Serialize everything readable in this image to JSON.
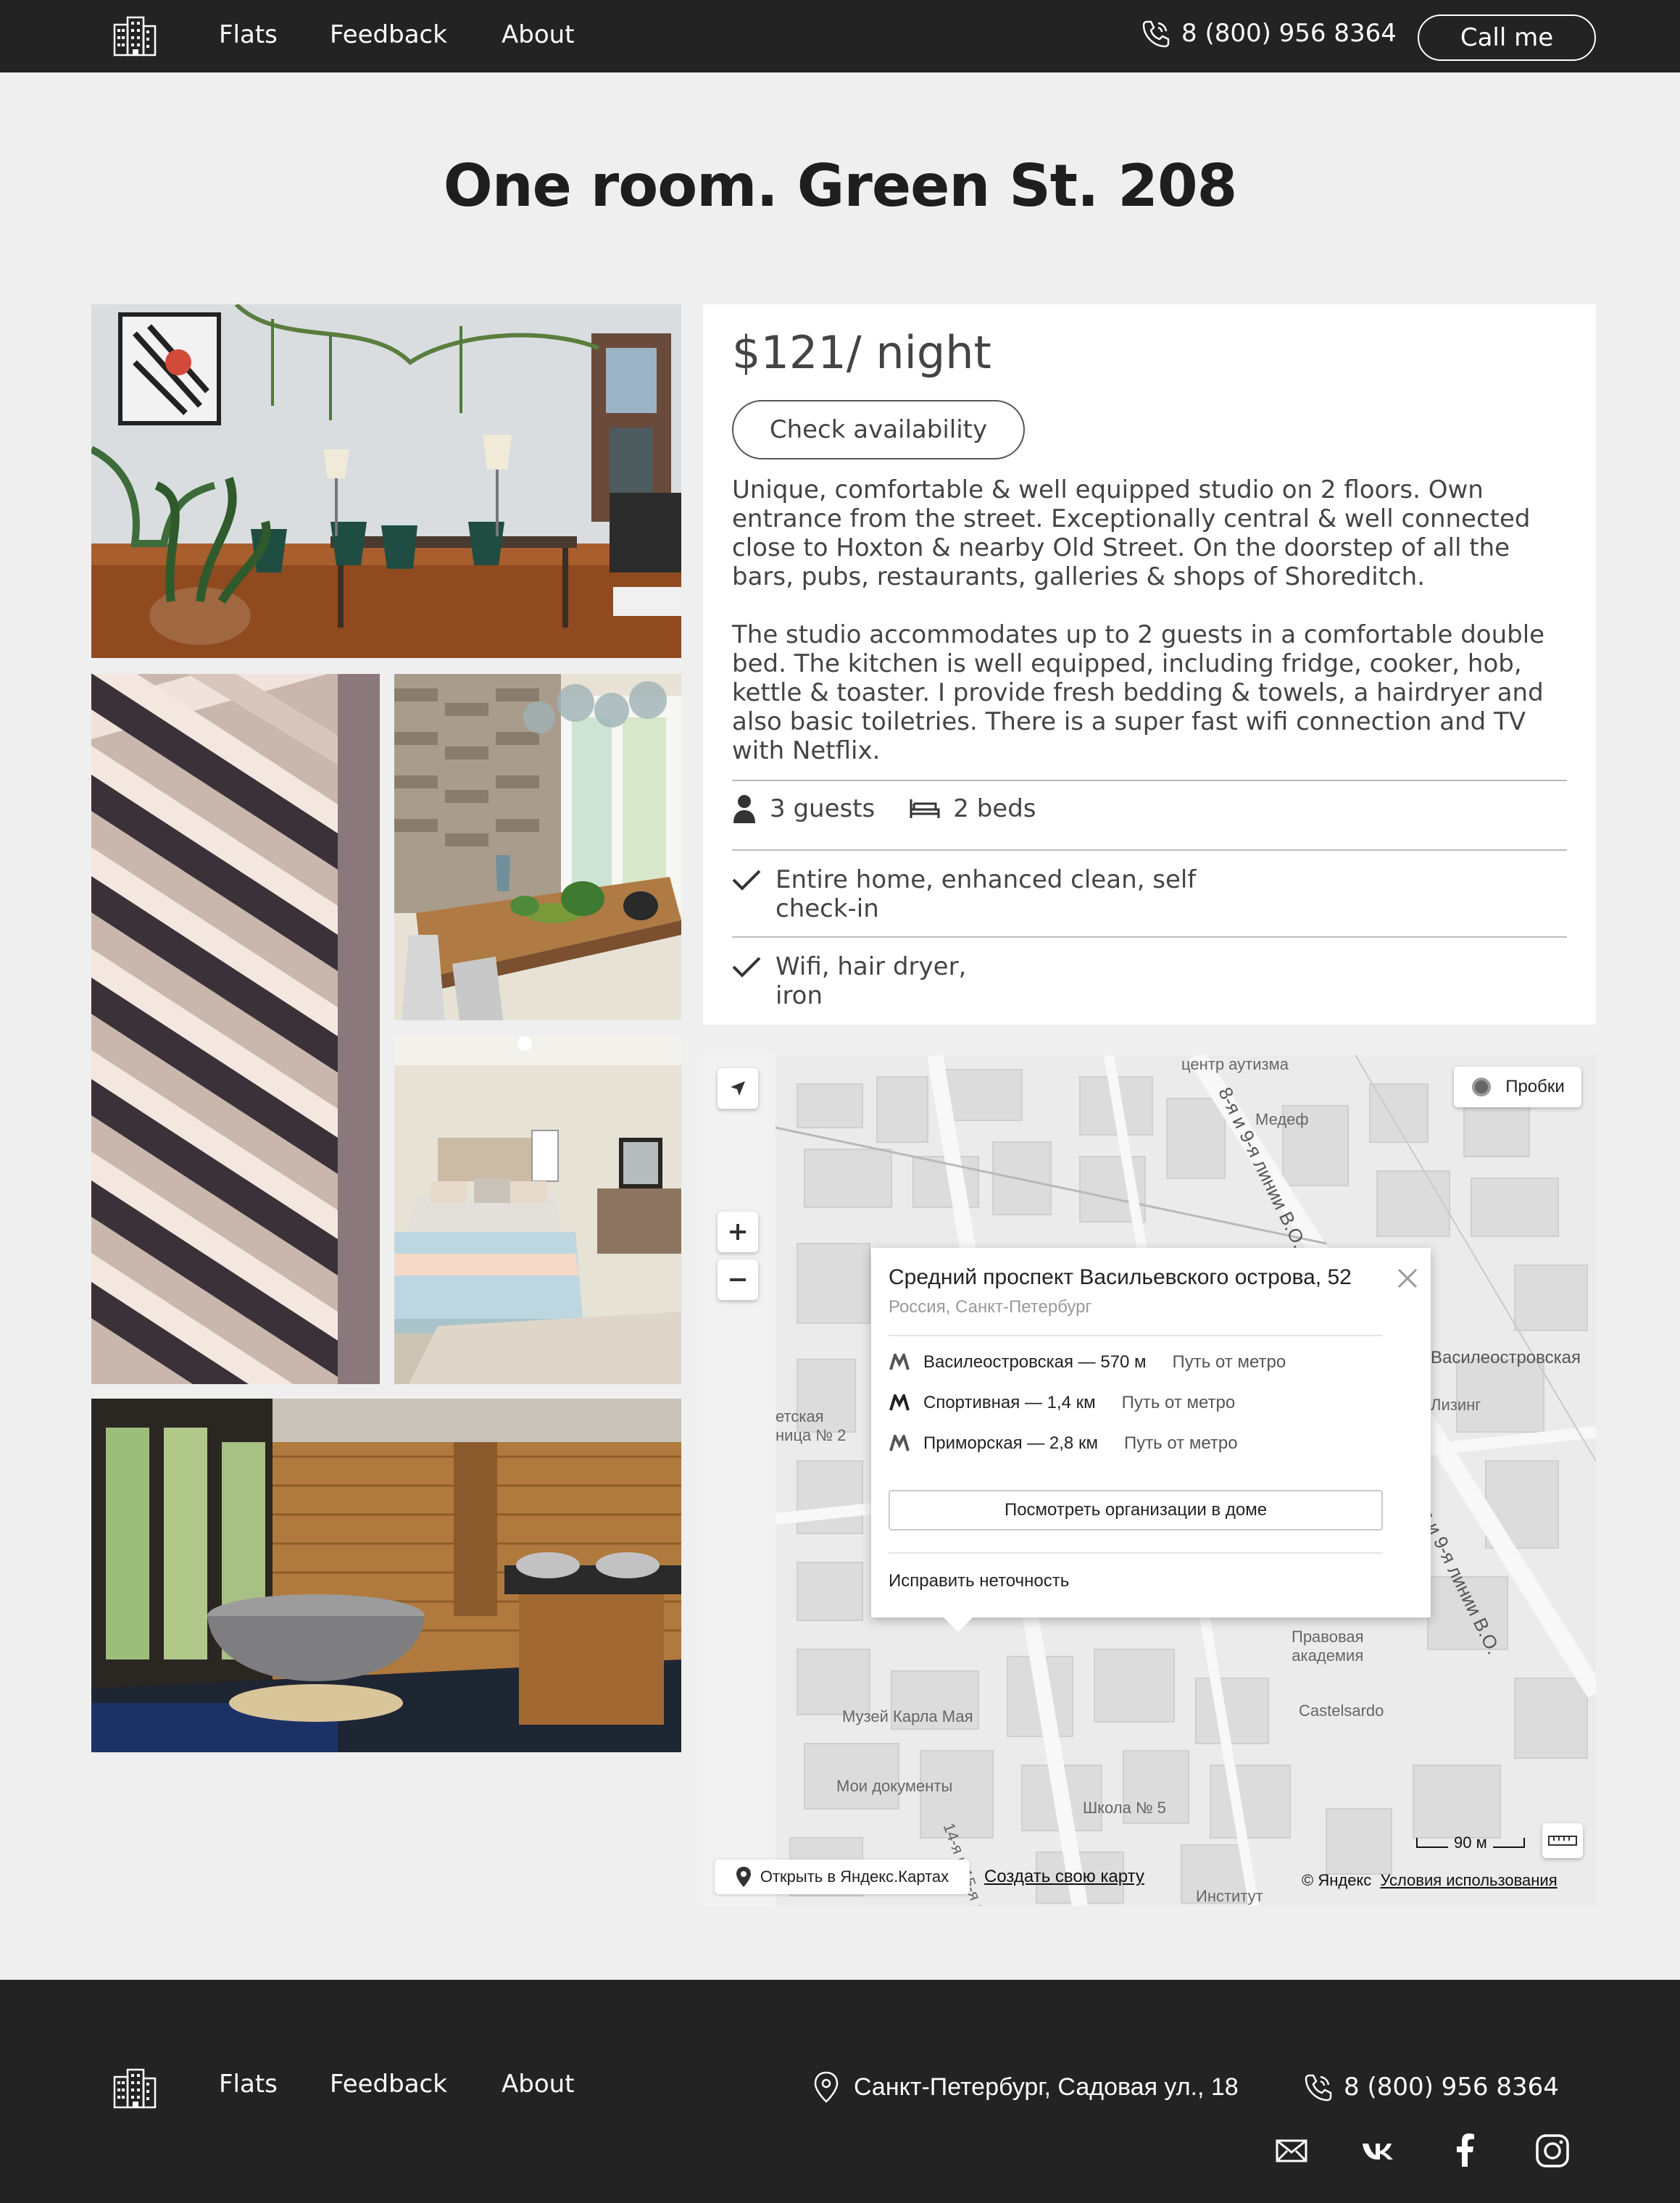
{
  "header": {
    "nav": [
      "Flats",
      "Feedback",
      "About"
    ],
    "phone": "8 (800) 956 8364",
    "call_button": "Call me"
  },
  "page": {
    "title": "One room. Green St. 208"
  },
  "listing": {
    "price": "$121/ night",
    "check_button": "Check availability",
    "description_1": "Unique, comfortable & well equipped studio on 2 floors. Own entrance from the street. Exceptionally central & well connected close to Hoxton & nearby Old Street. On the doorstep of all the bars, pubs, restaurants, galleries & shops of Shoreditch.",
    "description_2": "The studio accommodates up to 2 guests in a comfortable double bed. The kitchen is well equipped, including fridge, cooker, hob, kettle & toaster. I provide fresh bedding & towels, a hairdryer and also basic toiletries. There is a super fast wifi connection and TV with Netflix.",
    "guests": "3 guests",
    "beds": "2 beds",
    "feature_1_line1": "Entire home, enhanced clean, self",
    "feature_1_line2": "check-in",
    "feature_2_line1": "Wifi, hair dryer,",
    "feature_2_line2": "iron"
  },
  "map": {
    "traffic_button": "Пробки",
    "popup_title": "Средний проспект Васильевского острова, 52",
    "popup_subtitle": "Россия, Санкт-Петербург",
    "metro": [
      {
        "name": "Василеостровская — 570 м",
        "path": "Путь от метро"
      },
      {
        "name": "Спортивная — 1,4 км",
        "path": "Путь от метро"
      },
      {
        "name": "Приморская — 2,8 км",
        "path": "Путь от метро"
      }
    ],
    "orgs_button": "Посмотреть организации в доме",
    "fix_link": "Исправить неточность",
    "open_link": "Открыть в Яндекс.Картах",
    "create_link": "Создать свою карту",
    "copyright": "© Яндекс",
    "terms_link": "Условия использования",
    "scale": "90 м",
    "labels": {
      "center": "центр аутизма",
      "medef": "Медеф",
      "line_upper": "8-я и 9-я линии В.О.",
      "line_lower": "8-я и 9-я линии В.О.",
      "vasileo": "Василеостровская",
      "leasing": "Лизинг",
      "school_left": "етская\nница № 2",
      "museum": "Музей Карла Мая",
      "docs": "Мои документы",
      "school5": "Школа № 5",
      "academy": "Правовая\nакадемия",
      "castelsardo": "Castelsardo",
      "institute": "Институт",
      "line14": "14-я и 15-я ли"
    }
  },
  "footer": {
    "nav": [
      "Flats",
      "Feedback",
      "About"
    ],
    "address": "Санкт-Петербург, Садовая ул., 18",
    "phone": "8 (800) 956 8364"
  }
}
